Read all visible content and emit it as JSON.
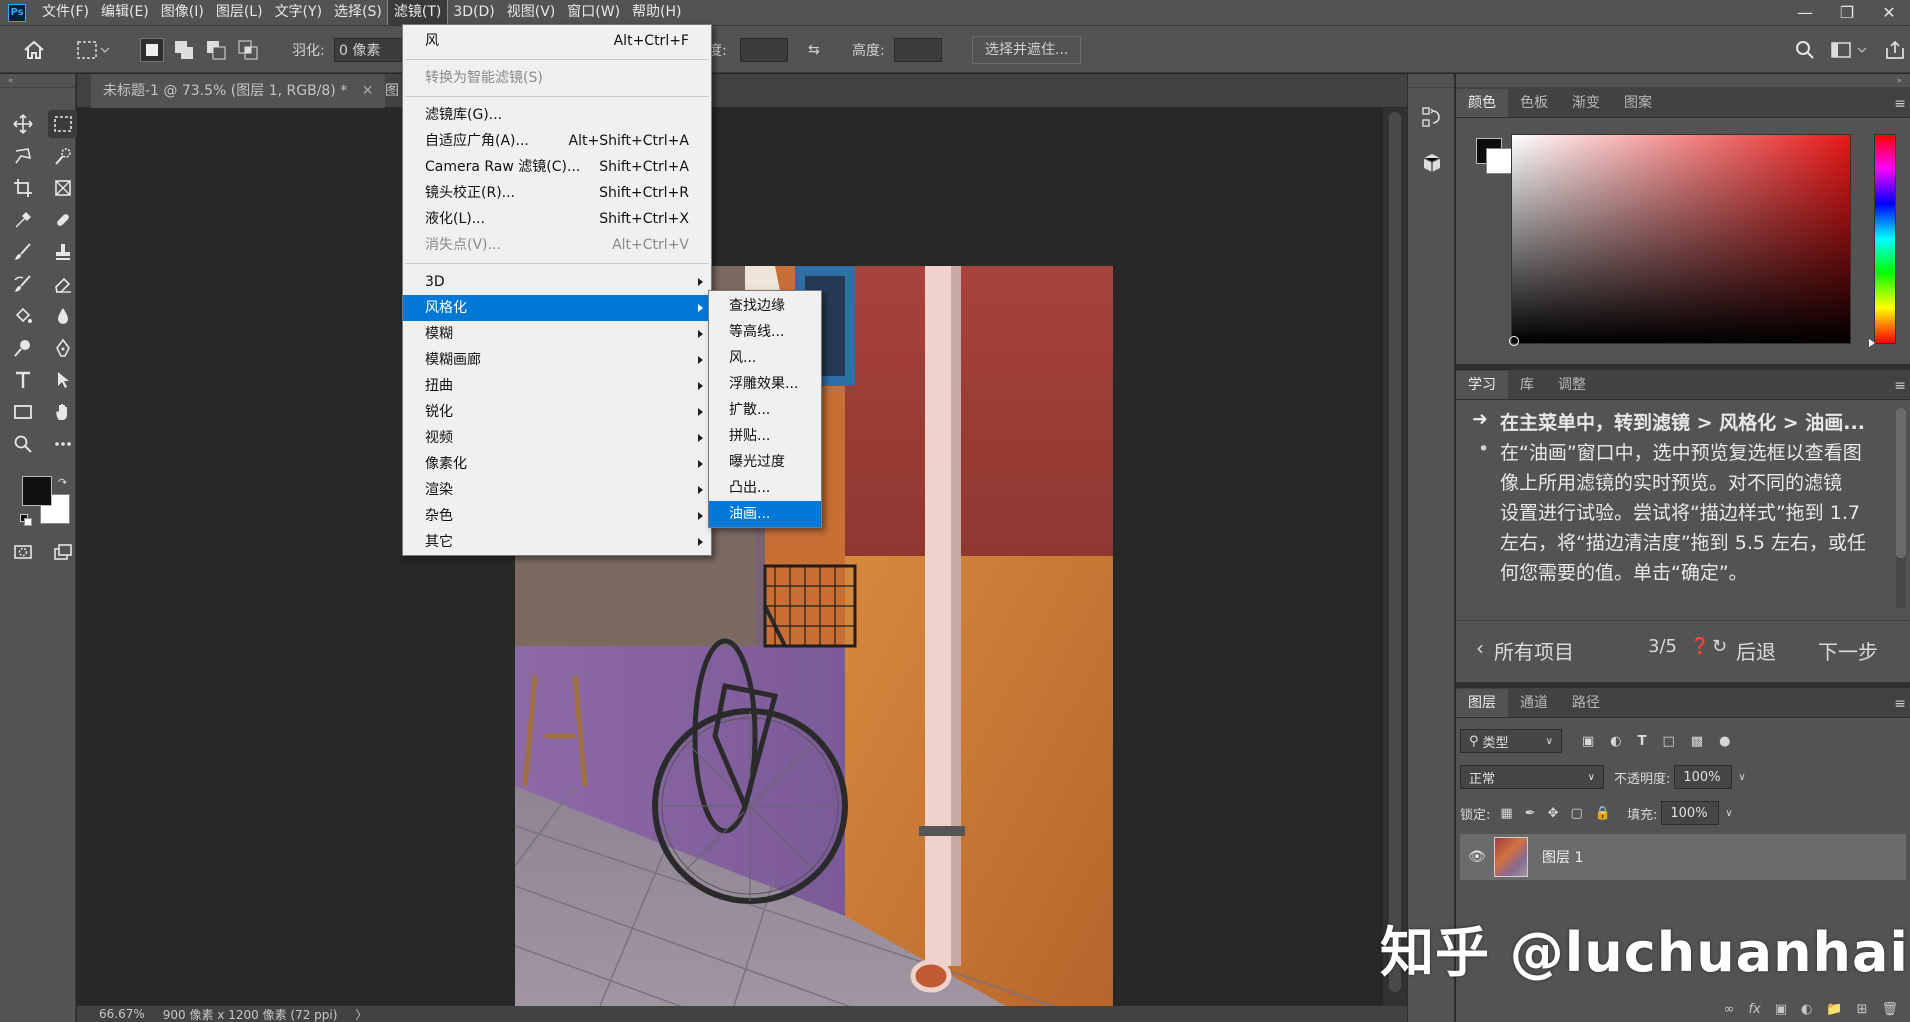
{
  "menubar": {
    "logo": "Ps",
    "items": [
      "文件(F)",
      "编辑(E)",
      "图像(I)",
      "图层(L)",
      "文字(Y)",
      "选择(S)",
      "滤镜(T)",
      "3D(D)",
      "视图(V)",
      "窗口(W)",
      "帮助(H)"
    ],
    "active_index": 6
  },
  "options": {
    "feather_label": "羽化:",
    "feather_value": "0 像素",
    "width_label": "度:",
    "height_label": "高度:",
    "select_mask": "选择并遮住..."
  },
  "doc": {
    "tab1": "未标题-1 @ 73.5% (图层 1, RGB/8) *",
    "tab2": "图"
  },
  "status": {
    "zoom": "66.67%",
    "size": "900 像素 x 1200 像素 (72 ppi)",
    "arrow": "〉"
  },
  "filter_menu": {
    "items": [
      {
        "label": "风",
        "shortcut": "Alt+Ctrl+F"
      },
      {
        "sep": true
      },
      {
        "label": "转换为智能滤镜(S)",
        "disabled": true
      },
      {
        "sep": true
      },
      {
        "label": "滤镜库(G)..."
      },
      {
        "label": "自适应广角(A)...",
        "shortcut": "Alt+Shift+Ctrl+A"
      },
      {
        "label": "Camera Raw 滤镜(C)...",
        "shortcut": "Shift+Ctrl+A"
      },
      {
        "label": "镜头校正(R)...",
        "shortcut": "Shift+Ctrl+R"
      },
      {
        "label": "液化(L)...",
        "shortcut": "Shift+Ctrl+X"
      },
      {
        "label": "消失点(V)...",
        "shortcut": "Alt+Ctrl+V",
        "disabled": true
      },
      {
        "sep": true
      },
      {
        "label": "3D",
        "sub": true
      },
      {
        "label": "风格化",
        "sub": true,
        "highlight": true
      },
      {
        "label": "模糊",
        "sub": true
      },
      {
        "label": "模糊画廊",
        "sub": true
      },
      {
        "label": "扭曲",
        "sub": true
      },
      {
        "label": "锐化",
        "sub": true
      },
      {
        "label": "视频",
        "sub": true
      },
      {
        "label": "像素化",
        "sub": true
      },
      {
        "label": "渲染",
        "sub": true
      },
      {
        "label": "杂色",
        "sub": true
      },
      {
        "label": "其它",
        "sub": true
      }
    ]
  },
  "stylize_menu": {
    "items": [
      {
        "label": "查找边缘"
      },
      {
        "label": "等高线..."
      },
      {
        "label": "风..."
      },
      {
        "label": "浮雕效果..."
      },
      {
        "label": "扩散..."
      },
      {
        "label": "拼贴..."
      },
      {
        "label": "曝光过度"
      },
      {
        "label": "凸出..."
      },
      {
        "label": "油画...",
        "highlight": true
      }
    ]
  },
  "color_panel": {
    "tabs": [
      "颜色",
      "色板",
      "渐变",
      "图案"
    ],
    "active": 0
  },
  "learn_panel": {
    "tabs": [
      "学习",
      "库",
      "调整"
    ],
    "active": 0,
    "step_line": "在主菜单中，转到滤镜 > 风格化 > 油画...",
    "bullet_lines": [
      "在“油画”窗口中，选中预览复选框以查看图",
      "像上所用滤镜的实时预览。对不同的滤镜",
      "设置进行试验。尝试将“描边样式”拖到 1.7",
      "左右，将“描边清洁度”拖到 5.5 左右，或任",
      "何您需要的值。单击“确定”。"
    ],
    "all_items": "所有项目",
    "progress": "3/5",
    "back": "后退",
    "next": "下一步"
  },
  "layers_panel": {
    "tabs": [
      "图层",
      "通道",
      "路径"
    ],
    "active": 0,
    "filter_kind": "类型",
    "blend_mode": "正常",
    "opacity_label": "不透明度:",
    "opacity_value": "100%",
    "lock_label": "锁定:",
    "fill_label": "填充:",
    "fill_value": "100%",
    "layer_name": "图层 1"
  },
  "watermark": "知乎 @luchuanhai"
}
